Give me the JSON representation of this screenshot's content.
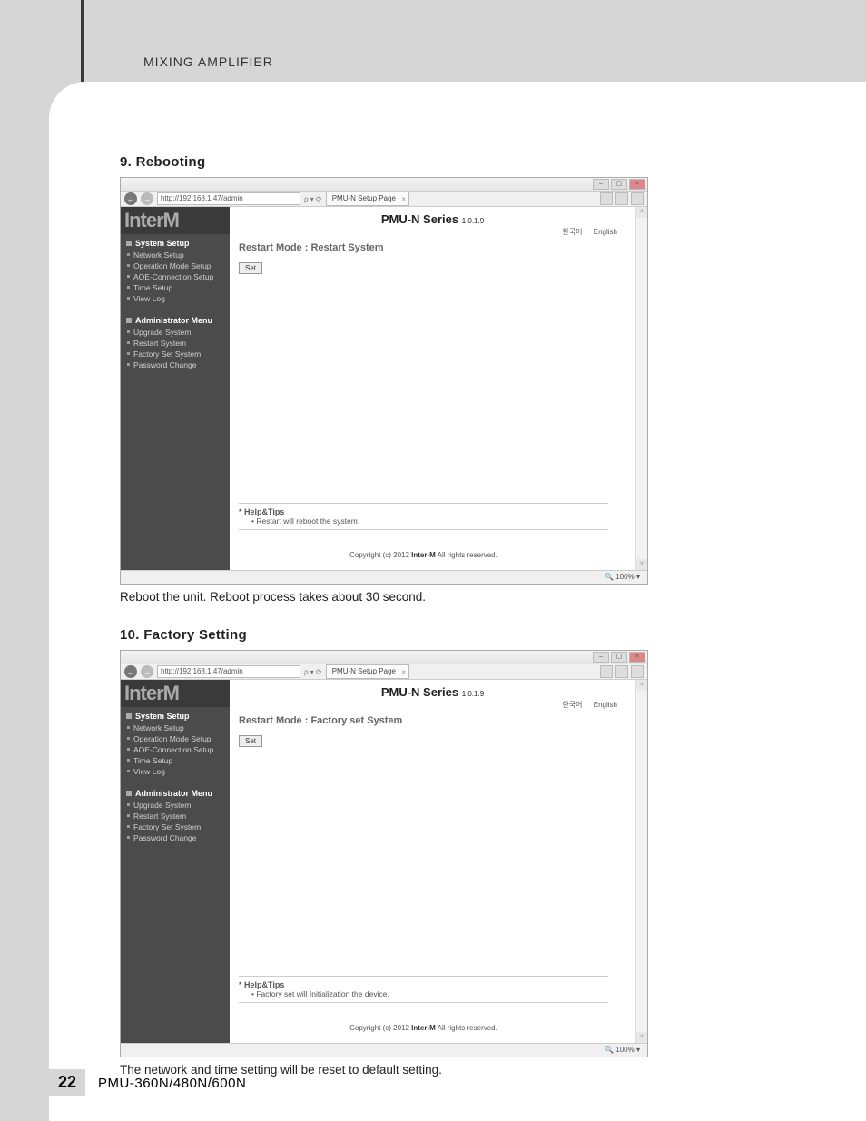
{
  "doc": {
    "running_head": "MIXING AMPLIFIER",
    "page_number": "22",
    "model": "PMU-360N/480N/600N"
  },
  "s1": {
    "heading": "9. Rebooting",
    "caption": "Reboot the unit. Reboot process takes about 30 second."
  },
  "s2": {
    "heading": "10. Factory Setting",
    "caption": "The network and time setting will be reset to default setting."
  },
  "browser": {
    "url": "http://192.168.1.47/admin",
    "tab_title": "PMU-N Setup Page",
    "zoom": "100%"
  },
  "webpage": {
    "logo": "InterM",
    "title": "PMU-N Series",
    "version": "1.0.1.9",
    "lang_ko": "한국어",
    "lang_en": "English",
    "set_button": "Set",
    "help_title": "* Help&Tips",
    "copyright_pre": "Copyright (c) 2012 ",
    "copyright_brand": "Inter-M",
    "copyright_post": " All rights reserved."
  },
  "menu": {
    "system": "System Setup",
    "system_items": [
      "Network Setup",
      "Operation Mode Setup",
      "AOE-Connection Setup",
      "Time Setup",
      "View Log"
    ],
    "admin": "Administrator Menu",
    "admin_items": [
      "Upgrade System",
      "Restart System",
      "Factory Set System",
      "Password Change"
    ]
  },
  "shot1": {
    "mode": "Restart Mode : Restart System",
    "help_item": "Restart will reboot the system."
  },
  "shot2": {
    "mode": "Restart Mode : Factory set System",
    "help_item": "Factory set will Initialization the device."
  }
}
